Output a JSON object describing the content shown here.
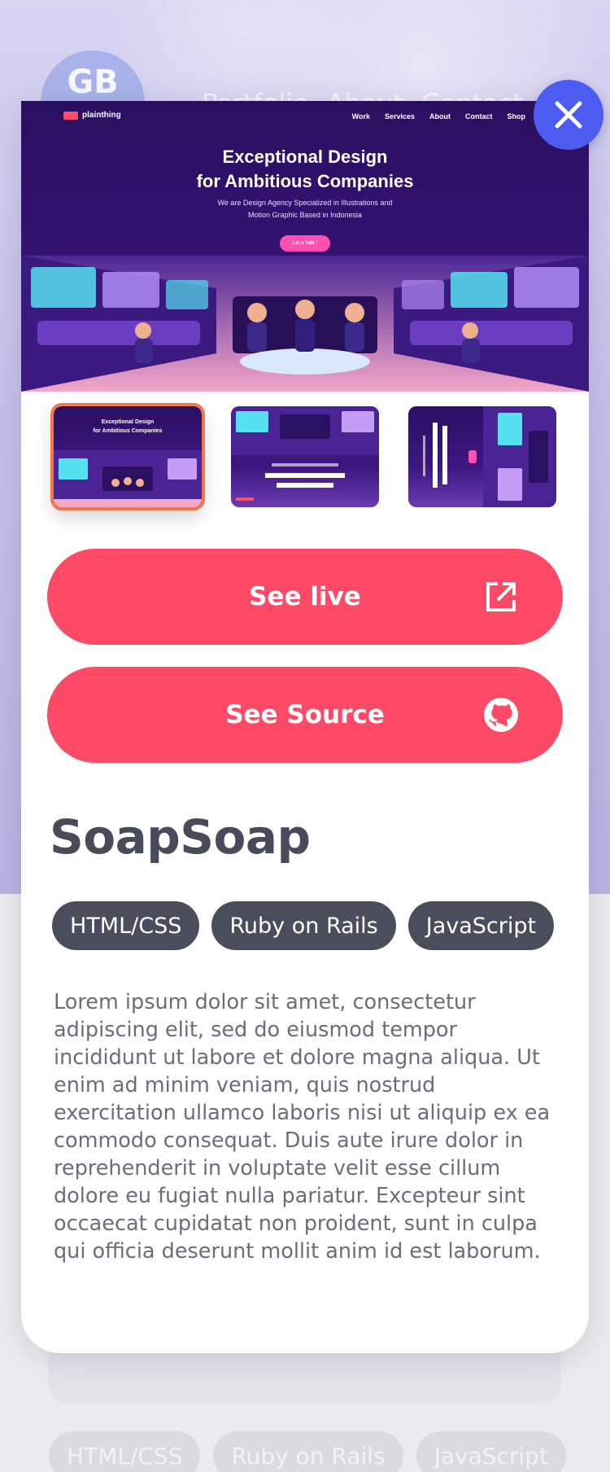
{
  "background": {
    "logo_text": "GB",
    "nav": [
      "Portfolio",
      "About",
      "Contact"
    ],
    "tags": [
      "HTML/CSS",
      "Ruby on Rails",
      "JavaScript"
    ]
  },
  "modal": {
    "screenshot": {
      "brand": "plainthing",
      "nav": [
        "Work",
        "Services",
        "About",
        "Contact",
        "Shop"
      ],
      "headline_1": "Exceptional Design",
      "headline_2": "for Ambitious Companies",
      "subline_1": "We are Design Agency Specialized in Illustrations and",
      "subline_2": "Motion Graphic Based in Indonesia",
      "cta": "Let's Talk !"
    },
    "thumbnails": [
      {
        "title_1": "Exceptional Design",
        "title_2": "for Ambitious Companies",
        "active": true
      },
      {
        "active": false
      },
      {
        "active": false
      }
    ],
    "see_live_label": "See live",
    "see_source_label": "See Source",
    "title": "SoapSoap",
    "tags": [
      "HTML/CSS",
      "Ruby on Rails",
      "JavaScript"
    ],
    "description": "Lorem ipsum dolor sit amet, consectetur adipiscing elit, sed do eiusmod tempor incididunt ut labore et dolore magna aliqua. Ut enim ad minim veniam, quis nostrud exercitation ullamco laboris nisi ut aliquip ex ea commodo consequat. Duis aute irure dolor in reprehenderit in voluptate velit esse cillum dolore eu fugiat nulla pariatur. Excepteur sint occaecat cupidatat non proident, sunt in culpa qui officia deserunt mollit anim id est laborum."
  },
  "icons": {
    "close": "close-icon",
    "see_live": "external-link-icon",
    "see_source": "github-icon"
  },
  "colors": {
    "accent": "#fe4a66",
    "close_button": "#4d5cf0",
    "tag_bg": "#4a4d5b",
    "title": "#474b5a",
    "active_thumb_border": "#f0774a"
  }
}
